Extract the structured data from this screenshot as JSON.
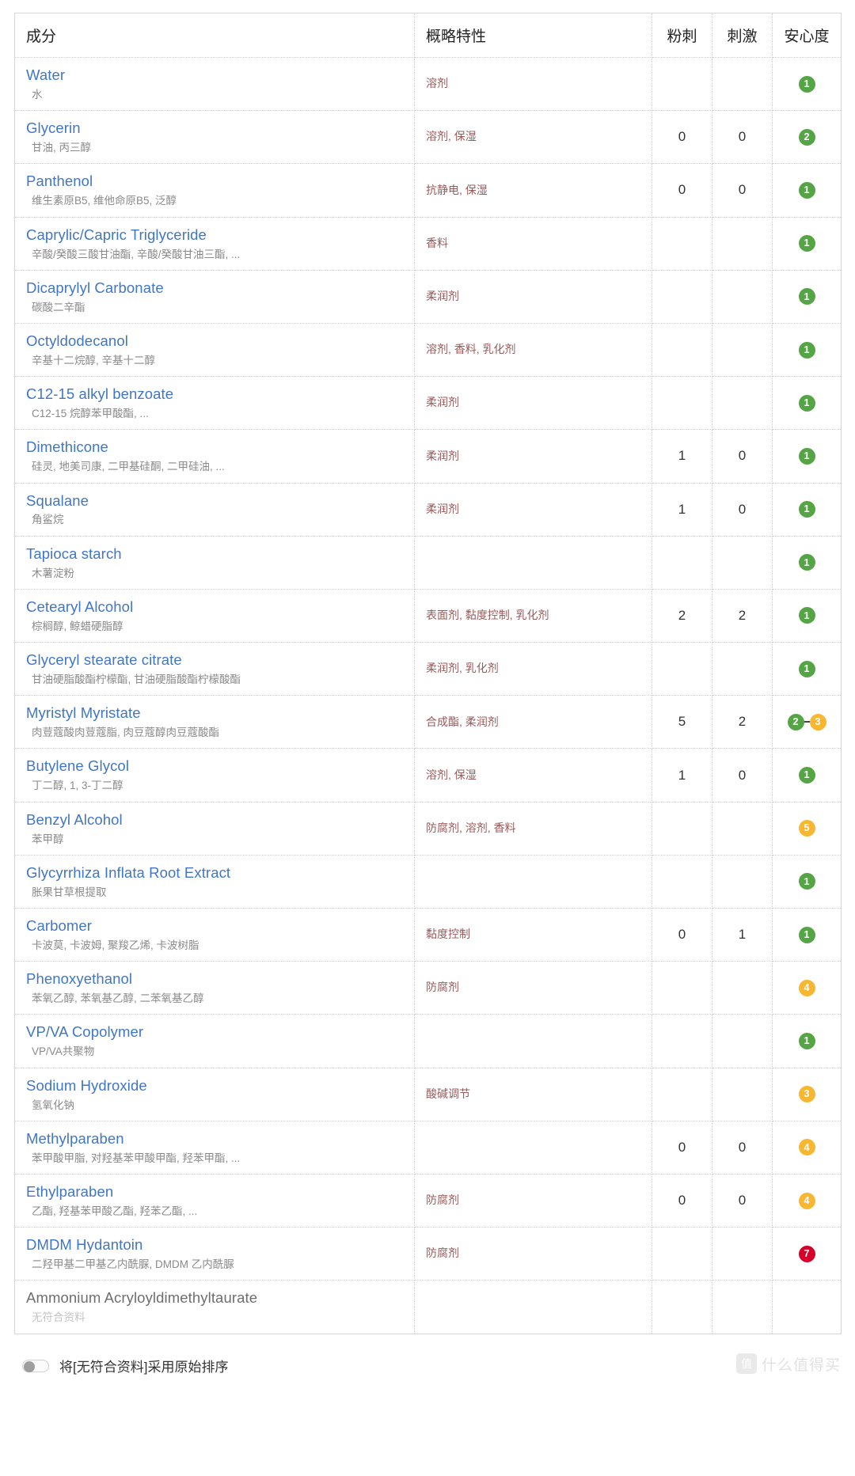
{
  "table": {
    "columns": [
      {
        "key": "name",
        "label": "成分"
      },
      {
        "key": "properties",
        "label": "概略特性"
      },
      {
        "key": "comedogenic",
        "label": "粉刺"
      },
      {
        "key": "irritation",
        "label": "刺激"
      },
      {
        "key": "safety",
        "label": "安心度"
      }
    ],
    "rows": [
      {
        "en": "Water",
        "cn": "水",
        "properties": "溶剂",
        "comedogenic": "",
        "irritation": "",
        "safety": [
          {
            "value": "1",
            "color": "green"
          }
        ],
        "inactive": false
      },
      {
        "en": "Glycerin",
        "cn": "甘油, 丙三醇",
        "properties": "溶剂, 保湿",
        "comedogenic": "0",
        "irritation": "0",
        "safety": [
          {
            "value": "2",
            "color": "green"
          }
        ],
        "inactive": false
      },
      {
        "en": "Panthenol",
        "cn": "维生素原B5, 维他命原B5, 泛醇",
        "properties": "抗静电, 保湿",
        "comedogenic": "0",
        "irritation": "0",
        "safety": [
          {
            "value": "1",
            "color": "green"
          }
        ],
        "inactive": false
      },
      {
        "en": "Caprylic/Capric Triglyceride",
        "cn": "辛酸/癸酸三酸甘油酯, 辛酸/癸酸甘油三酯, ...",
        "properties": "香料",
        "comedogenic": "",
        "irritation": "",
        "safety": [
          {
            "value": "1",
            "color": "green"
          }
        ],
        "inactive": false
      },
      {
        "en": "Dicaprylyl Carbonate",
        "cn": "碳酸二辛酯",
        "properties": "柔润剂",
        "comedogenic": "",
        "irritation": "",
        "safety": [
          {
            "value": "1",
            "color": "green"
          }
        ],
        "inactive": false
      },
      {
        "en": "Octyldodecanol",
        "cn": "辛基十二烷醇, 辛基十二醇",
        "properties": "溶剂, 香料, 乳化剂",
        "comedogenic": "",
        "irritation": "",
        "safety": [
          {
            "value": "1",
            "color": "green"
          }
        ],
        "inactive": false
      },
      {
        "en": "C12-15 alkyl benzoate",
        "cn": "C12-15 烷醇苯甲酸酯, ...",
        "properties": "柔润剂",
        "comedogenic": "",
        "irritation": "",
        "safety": [
          {
            "value": "1",
            "color": "green"
          }
        ],
        "inactive": false
      },
      {
        "en": "Dimethicone",
        "cn": "硅灵, 地美司康, 二甲基硅酮, 二甲硅油, ...",
        "properties": "柔润剂",
        "comedogenic": "1",
        "irritation": "0",
        "safety": [
          {
            "value": "1",
            "color": "green"
          }
        ],
        "inactive": false
      },
      {
        "en": "Squalane",
        "cn": "角鲨烷",
        "properties": "柔润剂",
        "comedogenic": "1",
        "irritation": "0",
        "safety": [
          {
            "value": "1",
            "color": "green"
          }
        ],
        "inactive": false
      },
      {
        "en": "Tapioca starch",
        "cn": "木薯淀粉",
        "properties": "",
        "comedogenic": "",
        "irritation": "",
        "safety": [
          {
            "value": "1",
            "color": "green"
          }
        ],
        "inactive": false
      },
      {
        "en": "Cetearyl Alcohol",
        "cn": "棕榈醇, 鲸蜡硬脂醇",
        "properties": "表面剂, 黏度控制, 乳化剂",
        "comedogenic": "2",
        "irritation": "2",
        "safety": [
          {
            "value": "1",
            "color": "green"
          }
        ],
        "inactive": false
      },
      {
        "en": "Glyceryl stearate citrate",
        "cn": "甘油硬脂酸酯柠檬酯, 甘油硬脂酸酯柠檬酸酯",
        "properties": "柔润剂, 乳化剂",
        "comedogenic": "",
        "irritation": "",
        "safety": [
          {
            "value": "1",
            "color": "green"
          }
        ],
        "inactive": false
      },
      {
        "en": "Myristyl Myristate",
        "cn": "肉荳蔻酸肉荳蔻脂, 肉豆蔻醇肉豆蔻酸酯",
        "properties": "合成酯, 柔润剂",
        "comedogenic": "5",
        "irritation": "2",
        "safety": [
          {
            "value": "2",
            "color": "green"
          },
          {
            "value": "3",
            "color": "orange"
          }
        ],
        "inactive": false
      },
      {
        "en": "Butylene Glycol",
        "cn": "丁二醇, 1, 3-丁二醇",
        "properties": "溶剂, 保湿",
        "comedogenic": "1",
        "irritation": "0",
        "safety": [
          {
            "value": "1",
            "color": "green"
          }
        ],
        "inactive": false
      },
      {
        "en": "Benzyl Alcohol",
        "cn": "苯甲醇",
        "properties": "防腐剂, 溶剂, 香料",
        "comedogenic": "",
        "irritation": "",
        "safety": [
          {
            "value": "5",
            "color": "orange"
          }
        ],
        "inactive": false
      },
      {
        "en": "Glycyrrhiza Inflata Root Extract",
        "cn": "胀果甘草根提取",
        "properties": "",
        "comedogenic": "",
        "irritation": "",
        "safety": [
          {
            "value": "1",
            "color": "green"
          }
        ],
        "inactive": false
      },
      {
        "en": "Carbomer",
        "cn": "卡波莫, 卡波姆, 聚羧乙烯, 卡波树脂",
        "properties": "黏度控制",
        "comedogenic": "0",
        "irritation": "1",
        "safety": [
          {
            "value": "1",
            "color": "green"
          }
        ],
        "inactive": false
      },
      {
        "en": "Phenoxyethanol",
        "cn": "苯氧乙醇, 苯氧基乙醇, 二苯氧基乙醇",
        "properties": "防腐剂",
        "comedogenic": "",
        "irritation": "",
        "safety": [
          {
            "value": "4",
            "color": "orange"
          }
        ],
        "inactive": false
      },
      {
        "en": "VP/VA Copolymer",
        "cn": "VP/VA共聚物",
        "properties": "",
        "comedogenic": "",
        "irritation": "",
        "safety": [
          {
            "value": "1",
            "color": "green"
          }
        ],
        "inactive": false
      },
      {
        "en": "Sodium Hydroxide",
        "cn": "氢氧化钠",
        "properties": "酸碱调节",
        "comedogenic": "",
        "irritation": "",
        "safety": [
          {
            "value": "3",
            "color": "orange"
          }
        ],
        "inactive": false
      },
      {
        "en": "Methylparaben",
        "cn": "苯甲酸甲脂, 对羟基苯甲酸甲酯, 羟苯甲酯, ...",
        "properties": "",
        "comedogenic": "0",
        "irritation": "0",
        "safety": [
          {
            "value": "4",
            "color": "orange"
          }
        ],
        "inactive": false
      },
      {
        "en": "Ethylparaben",
        "cn": "乙酯, 羟基苯甲酸乙酯, 羟苯乙酯, ...",
        "properties": "防腐剂",
        "comedogenic": "0",
        "irritation": "0",
        "safety": [
          {
            "value": "4",
            "color": "orange"
          }
        ],
        "inactive": false
      },
      {
        "en": "DMDM Hydantoin",
        "cn": "二羟甲基二甲基乙内酰脲, DMDM 乙内酰脲",
        "properties": "防腐剂",
        "comedogenic": "",
        "irritation": "",
        "safety": [
          {
            "value": "7",
            "color": "red"
          }
        ],
        "inactive": false
      },
      {
        "en": "Ammonium Acryloyldimethyltaurate",
        "cn": "无符合资料",
        "properties": "",
        "comedogenic": "",
        "irritation": "",
        "safety": [],
        "inactive": true
      }
    ]
  },
  "footer": {
    "toggle_label": "将[无符合资料]采用原始排序",
    "toggle_on": false,
    "watermark_logo": "值",
    "watermark_text": "什么值得买"
  },
  "colors": {
    "green": "#55a445",
    "orange": "#f7b731",
    "red": "#d6002b",
    "link": "#4176c4",
    "property_text": "#9a5a5a"
  }
}
